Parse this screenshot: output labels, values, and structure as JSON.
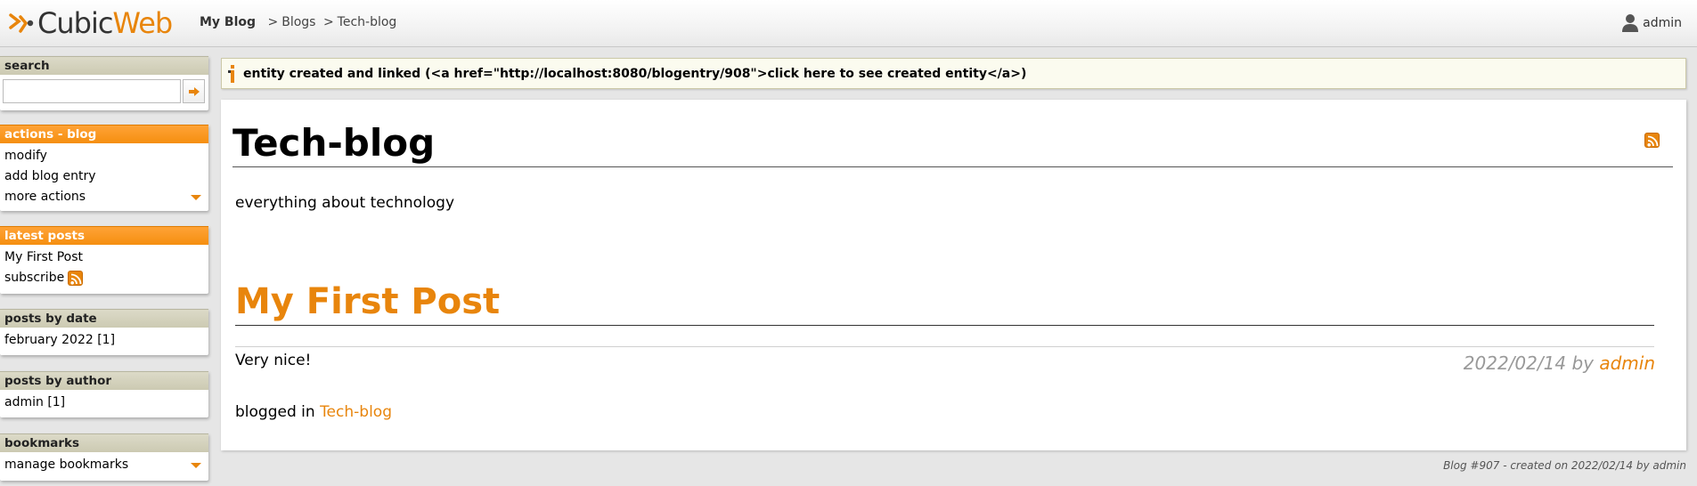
{
  "header": {
    "logo": {
      "part1": "Cubic",
      "part2": "Web"
    },
    "breadcrumb": {
      "root": "My Blog",
      "items": [
        "Blogs",
        "Tech-blog"
      ],
      "separator": ">"
    },
    "user": "admin"
  },
  "sidebar": {
    "search": {
      "title": "search",
      "placeholder": ""
    },
    "actions": {
      "title": "actions - blog",
      "items": [
        "modify",
        "add blog entry",
        "more actions"
      ]
    },
    "latest_posts": {
      "title": "latest posts",
      "items": [
        "My First Post"
      ],
      "subscribe": "subscribe"
    },
    "posts_by_date": {
      "title": "posts by date",
      "items": [
        "february 2022 [1]"
      ]
    },
    "posts_by_author": {
      "title": "posts by author",
      "items": [
        "admin [1]"
      ]
    },
    "bookmarks": {
      "title": "bookmarks",
      "items": [
        "manage bookmarks"
      ]
    }
  },
  "message": "entity created and linked (<a href=\"http://localhost:8080/blogentry/908\">click here to see created entity</a>)",
  "blog": {
    "title": "Tech-blog",
    "description": "everything about technology"
  },
  "post": {
    "title": "My First Post",
    "body": "Very nice!",
    "date": "2022/02/14",
    "by": "by",
    "author": "admin",
    "blogged_in_label": "blogged in",
    "blog_link": "Tech-blog"
  },
  "footer": "Blog #907 - created on 2022/02/14 by admin",
  "colors": {
    "accent": "#e8850c",
    "box_header": "#cccab2",
    "message_bg": "#fbfbef"
  },
  "icons": [
    "cubicweb-logo-icon",
    "user-icon",
    "search-go-icon",
    "chevron-down-icon",
    "rss-icon",
    "info-icon"
  ]
}
